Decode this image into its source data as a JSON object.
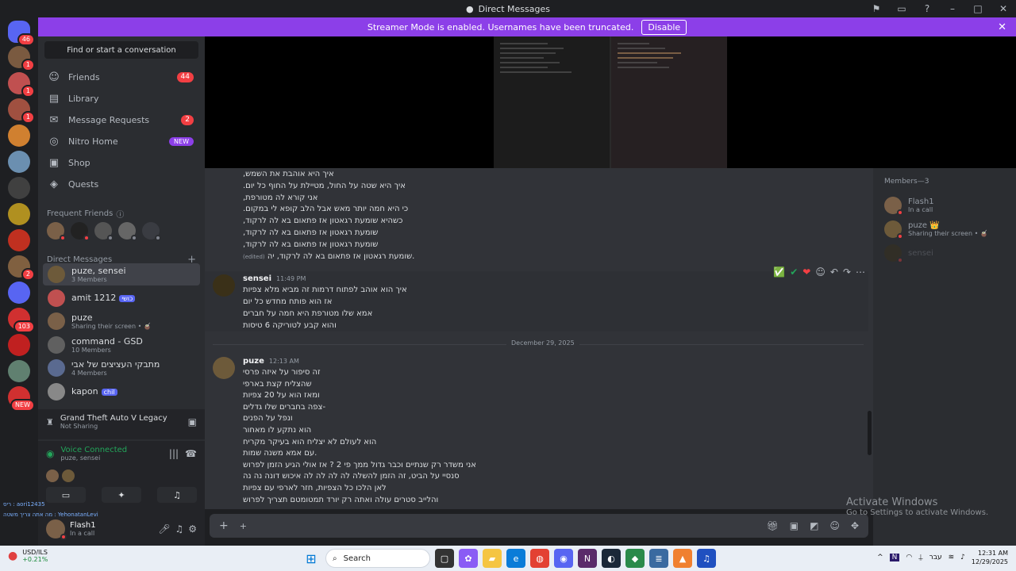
{
  "window": {
    "title": "Direct Messages"
  },
  "banner": {
    "text": "Streamer Mode is enabled. Usernames have been truncated.",
    "button": "Disable"
  },
  "rail": {
    "home_badge": "46",
    "servers": [
      {
        "color": "#7a5a40",
        "badge": "1"
      },
      {
        "color": "#c05050",
        "badge": "1"
      },
      {
        "color": "#a05040",
        "badge": "1"
      },
      {
        "color": "#d08030",
        "badge": ""
      },
      {
        "color": "#6b8fb0",
        "badge": ""
      },
      {
        "color": "#404040",
        "badge": ""
      },
      {
        "color": "#b09020",
        "badge": ""
      },
      {
        "color": "#c03020",
        "badge": ""
      },
      {
        "color": "#806040",
        "badge": "2"
      },
      {
        "color": "#5865f2",
        "badge": ""
      },
      {
        "color": "#d03030",
        "badge": "103"
      },
      {
        "color": "#c02020",
        "badge": ""
      },
      {
        "color": "#608070",
        "badge": ""
      },
      {
        "color": "#d03030",
        "badge": "NEW"
      }
    ]
  },
  "sidebar": {
    "search_placeholder": "Find or start a conversation",
    "nav": [
      {
        "label": "Friends",
        "icon": "☺",
        "count": "44"
      },
      {
        "label": "Library",
        "icon": "▤",
        "count": ""
      },
      {
        "label": "Message Requests",
        "icon": "✉",
        "count": "2"
      },
      {
        "label": "Nitro Home",
        "icon": "◎",
        "count": ""
      },
      {
        "label": "Shop",
        "icon": "▣",
        "count": ""
      },
      {
        "label": "Quests",
        "icon": "◈",
        "count": ""
      }
    ],
    "nitro_new": "NEW",
    "frequent_friends": "Frequent Friends",
    "direct_messages": "Direct Messages",
    "dms": [
      {
        "name": "puze, sensei",
        "sub": "3 Members",
        "tag": ""
      },
      {
        "name": "amit 1212",
        "sub": "",
        "tag": "כושי"
      },
      {
        "name": "puze",
        "sub": "Sharing their screen • 🧉",
        "tag": ""
      },
      {
        "name": "command - GSD",
        "sub": "10 Members",
        "tag": ""
      },
      {
        "name": "מתבקי העציצים של אבי",
        "sub": "4 Members",
        "tag": ""
      },
      {
        "name": "kapon",
        "sub": "",
        "tag": "chil"
      }
    ],
    "game": {
      "title": "Grand Theft Auto V Legacy",
      "sub": "Not Sharing"
    },
    "voice": {
      "status": "Voice Connected",
      "channel": "puze, sensei"
    },
    "user": {
      "name": "Flash1",
      "status": "In a call"
    },
    "overlay_texts": [
      "ריס : aori12435",
      "מה אתה צריך משטה : YehonatanLevi"
    ]
  },
  "chat": {
    "prev_lines": [
      "איך היא אוהבת את השמש,",
      "איך היא שטה על החול, מטיילת על החוף כל יום.",
      "אני קורא לה מטורפת,",
      "כי היא חמה יותר מאש אבל הלב קופא לי במקום.",
      "כשהיא שומעת רגאטון אז פתאום בא לה לרקוד,",
      "שומעת רגאטון אז פתאום בא לה לרקוד,",
      "שומעת רגאטון אז פתאום בא לה לרקוד,",
      "שומעת רגאטון אז פתאום בא לה לרקוד, יה."
    ],
    "edited": "(edited)",
    "msg1": {
      "author": "sensei",
      "time": "11:49 PM",
      "lines": [
        "איך הוא אוהב לפתוח דרמות זה מביא מלא צפיות",
        "אז הוא פותח מחדש כל יום",
        "אמא שלו מטורפת היא חמה על חברים",
        "והוא קבע לטוריקה 6 טיסות"
      ]
    },
    "date_divider": "December 29, 2025",
    "msg2": {
      "author": "puze",
      "time": "12:13 AM",
      "lines": [
        "זה סיפור על איזה פרסי",
        "שהצליח קצת בארפי",
        "ומאז הוא על 20 צפיות",
        "-צפה בחברים שלו גדלים",
        "ונפל על הפנים",
        "הוא נתקע לו מאחור",
        "הוא לעולם לא יצליח הוא בעיקר מקריח",
        ".עם אמא משנה שמות",
        "אני משדר רק שנתיים וכבר גדול ממך פי 2 ? אז אולי הגיע הזמן לפרוש",
        "סנסיי על הביט, זה הזמן להשלה לה לה לה לה איכוש דונה נה נה",
        "לאן הלכו כל הצפיות, חזר לארפי עם צפיות",
        "והלייב סטרים עולה ואתה רק יורד תמטומטם תצריך לפרוש"
      ]
    },
    "actions": [
      "✅",
      "✔",
      "❤",
      "☺",
      "↶",
      "↷",
      "⋯"
    ]
  },
  "members": {
    "header": "Members—3",
    "list": [
      {
        "name": "Flash1",
        "status": "In a call"
      },
      {
        "name": "puze 👑",
        "status": "Sharing their screen • 🧉"
      },
      {
        "name": "sensei",
        "status": ""
      }
    ]
  },
  "activate": {
    "title": "Activate Windows",
    "sub": "Go to Settings to activate Windows."
  },
  "taskbar": {
    "weather_label": "USD/ILS",
    "weather_value": "+0.21%",
    "search": "Search",
    "lang": "עבר",
    "time": "12:31 AM",
    "date": "12/29/2025"
  }
}
